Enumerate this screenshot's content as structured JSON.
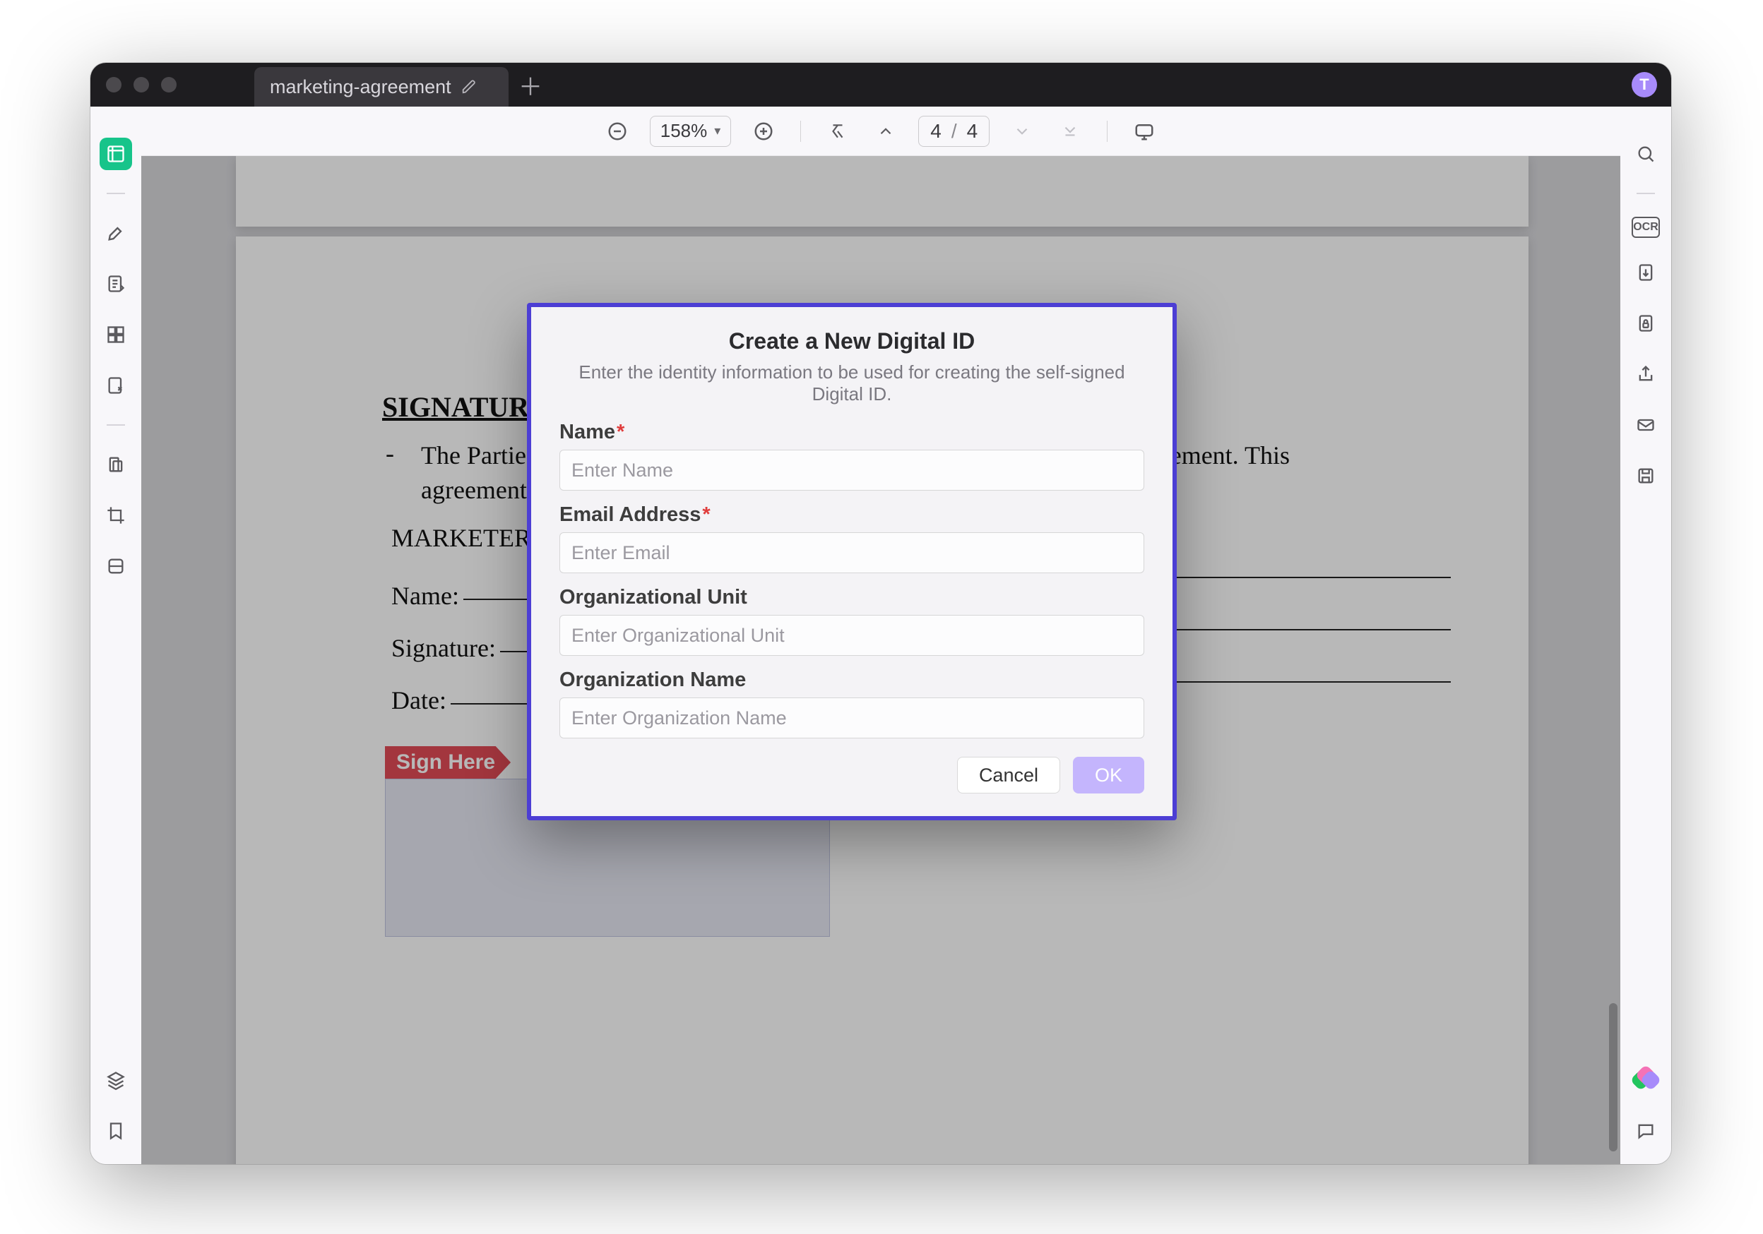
{
  "window": {
    "tab_title": "marketing-agreement",
    "avatar_initial": "T"
  },
  "toolbar": {
    "zoom_value": "158%",
    "page_current": "4",
    "page_total": "4"
  },
  "left_rail": {
    "items": [
      {
        "name": "thumbnails",
        "active": true
      },
      {
        "name": "annotate"
      },
      {
        "name": "fill-sign"
      },
      {
        "name": "edit-pdf"
      },
      {
        "name": "form"
      },
      {
        "name": "redact"
      },
      {
        "name": "page-organize"
      },
      {
        "name": "ocr-lite"
      }
    ],
    "bottom": [
      {
        "name": "layers"
      },
      {
        "name": "bookmarks"
      }
    ]
  },
  "right_rail": {
    "items": [
      {
        "name": "search"
      },
      {
        "name": "ocr"
      },
      {
        "name": "convert"
      },
      {
        "name": "protect"
      },
      {
        "name": "share"
      },
      {
        "name": "email"
      },
      {
        "name": "save"
      }
    ],
    "bottom": [
      {
        "name": "copilot"
      },
      {
        "name": "comments"
      }
    ]
  },
  "document": {
    "section_title": "SIGNATURE AND DATE",
    "paragraph_line1": "The Parties hereby agree to the terms and conditions set forth in this Agreement. This",
    "paragraph_line2": "agreement is demonstrated by their signatures below:",
    "role_left": "MARKETER",
    "label_name": "Name:",
    "label_signature": "Signature:",
    "label_date": "Date:",
    "sign_here": "Sign Here"
  },
  "dialog": {
    "title": "Create a New Digital ID",
    "subtitle": "Enter the identity information to be used for creating the self-signed Digital ID.",
    "fields": {
      "name": {
        "label": "Name",
        "required": true,
        "placeholder": "Enter Name"
      },
      "email": {
        "label": "Email Address",
        "required": true,
        "placeholder": "Enter Email"
      },
      "org_unit": {
        "label": "Organizational Unit",
        "required": false,
        "placeholder": "Enter Organizational Unit"
      },
      "org_name": {
        "label": "Organization Name",
        "required": false,
        "placeholder": "Enter Organization Name"
      }
    },
    "buttons": {
      "cancel": "Cancel",
      "ok": "OK"
    }
  }
}
